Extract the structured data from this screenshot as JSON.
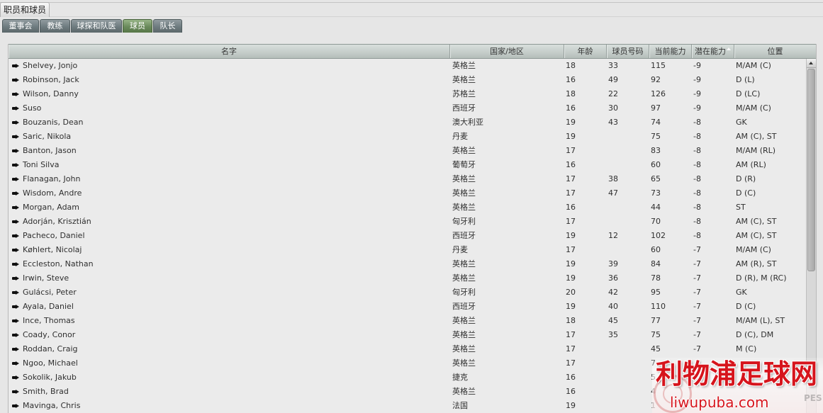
{
  "window": {
    "title": "职员和球员"
  },
  "tabs": [
    {
      "label": "董事会",
      "selected": false
    },
    {
      "label": "教练",
      "selected": false
    },
    {
      "label": "球探和队医",
      "selected": false
    },
    {
      "label": "球员",
      "selected": true
    },
    {
      "label": "队长",
      "selected": false
    }
  ],
  "table": {
    "columns": [
      {
        "label": "名字"
      },
      {
        "label": "国家/地区"
      },
      {
        "label": "年龄"
      },
      {
        "label": "球员号码"
      },
      {
        "label": "当前能力"
      },
      {
        "label": "潜在能力",
        "sorted": true,
        "sort_ascending": true
      },
      {
        "label": "位置"
      }
    ],
    "rows": [
      {
        "name": "Shelvey, Jonjo",
        "nation": "英格兰",
        "age": 18,
        "number": 33,
        "current_ability": 115,
        "potential_ability": -9,
        "position": "M/AM (C)"
      },
      {
        "name": "Robinson, Jack",
        "nation": "英格兰",
        "age": 16,
        "number": 49,
        "current_ability": 92,
        "potential_ability": -9,
        "position": "D (L)"
      },
      {
        "name": "Wilson, Danny",
        "nation": "苏格兰",
        "age": 18,
        "number": 22,
        "current_ability": 126,
        "potential_ability": -9,
        "position": "D (LC)"
      },
      {
        "name": "Suso",
        "nation": "西班牙",
        "age": 16,
        "number": 30,
        "current_ability": 97,
        "potential_ability": -9,
        "position": "M/AM (C)"
      },
      {
        "name": "Bouzanis, Dean",
        "nation": "澳大利亚",
        "age": 19,
        "number": 43,
        "current_ability": 74,
        "potential_ability": -8,
        "position": "GK"
      },
      {
        "name": "Saric, Nikola",
        "nation": "丹麦",
        "age": 19,
        "number": "",
        "current_ability": 75,
        "potential_ability": -8,
        "position": "AM (C), ST"
      },
      {
        "name": "Banton, Jason",
        "nation": "英格兰",
        "age": 17,
        "number": "",
        "current_ability": 83,
        "potential_ability": -8,
        "position": "M/AM (RL)"
      },
      {
        "name": "Toni Silva",
        "nation": "葡萄牙",
        "age": 16,
        "number": "",
        "current_ability": 60,
        "potential_ability": -8,
        "position": "AM (RL)"
      },
      {
        "name": "Flanagan, John",
        "nation": "英格兰",
        "age": 17,
        "number": 38,
        "current_ability": 65,
        "potential_ability": -8,
        "position": "D (R)"
      },
      {
        "name": "Wisdom, Andre",
        "nation": "英格兰",
        "age": 17,
        "number": 47,
        "current_ability": 73,
        "potential_ability": -8,
        "position": "D (C)"
      },
      {
        "name": "Morgan, Adam",
        "nation": "英格兰",
        "age": 16,
        "number": "",
        "current_ability": 44,
        "potential_ability": -8,
        "position": "ST"
      },
      {
        "name": "Adorján, Krisztián",
        "nation": "匈牙利",
        "age": 17,
        "number": "",
        "current_ability": 70,
        "potential_ability": -8,
        "position": "AM (C), ST"
      },
      {
        "name": "Pacheco, Daniel",
        "nation": "西班牙",
        "age": 19,
        "number": 12,
        "current_ability": 102,
        "potential_ability": -8,
        "position": "AM (C), ST"
      },
      {
        "name": "Køhlert, Nicolaj",
        "nation": "丹麦",
        "age": 17,
        "number": "",
        "current_ability": 60,
        "potential_ability": -7,
        "position": "M/AM (C)"
      },
      {
        "name": "Eccleston, Nathan",
        "nation": "英格兰",
        "age": 19,
        "number": 39,
        "current_ability": 84,
        "potential_ability": -7,
        "position": "AM (R), ST"
      },
      {
        "name": "Irwin, Steve",
        "nation": "英格兰",
        "age": 19,
        "number": 36,
        "current_ability": 78,
        "potential_ability": -7,
        "position": "D (R), M (RC)"
      },
      {
        "name": "Gulácsi, Peter",
        "nation": "匈牙利",
        "age": 20,
        "number": 42,
        "current_ability": 95,
        "potential_ability": -7,
        "position": "GK"
      },
      {
        "name": "Ayala, Daniel",
        "nation": "西班牙",
        "age": 19,
        "number": 40,
        "current_ability": 110,
        "potential_ability": -7,
        "position": "D (C)"
      },
      {
        "name": "Ince, Thomas",
        "nation": "英格兰",
        "age": 18,
        "number": 45,
        "current_ability": 77,
        "potential_ability": -7,
        "position": "M/AM (L), ST"
      },
      {
        "name": "Coady, Conor",
        "nation": "英格兰",
        "age": 17,
        "number": 35,
        "current_ability": 75,
        "potential_ability": -7,
        "position": "D (C), DM"
      },
      {
        "name": "Roddan, Craig",
        "nation": "英格兰",
        "age": 17,
        "number": "",
        "current_ability": 45,
        "potential_ability": -7,
        "position": "M (C)"
      },
      {
        "name": "Ngoo, Michael",
        "nation": "英格兰",
        "age": 17,
        "number": "",
        "current_ability": "7",
        "potential_ability": "",
        "position": ""
      },
      {
        "name": "Sokolik, Jakub",
        "nation": "捷克",
        "age": 16,
        "number": "",
        "current_ability": "5",
        "potential_ability": "",
        "position": ""
      },
      {
        "name": "Smith, Brad",
        "nation": "英格兰",
        "age": 16,
        "number": "",
        "current_ability": "4",
        "potential_ability": "",
        "position": ""
      },
      {
        "name": "Mavinga, Chris",
        "nation": "法国",
        "age": 19,
        "number": "",
        "current_ability": "1",
        "potential_ability": "",
        "position": ""
      }
    ]
  },
  "watermark": {
    "title": "利物浦足球网",
    "url": "liwupuba.com",
    "brand": "PES"
  },
  "icons": {
    "row_action": "row-action-pointer-icon",
    "sort": "sort-ascending-icon",
    "scroll_up": "scroll-up-arrow-icon",
    "crest": "watermark-crest-icon"
  },
  "colors": {
    "background": "#e6e6e6",
    "table": "#ebebeb",
    "header": "#c4ccc9",
    "tab": "#6e7b7f",
    "tab_selected": "#6a8a5b",
    "text": "#2f2f2f",
    "watermark": "#d6141c"
  }
}
